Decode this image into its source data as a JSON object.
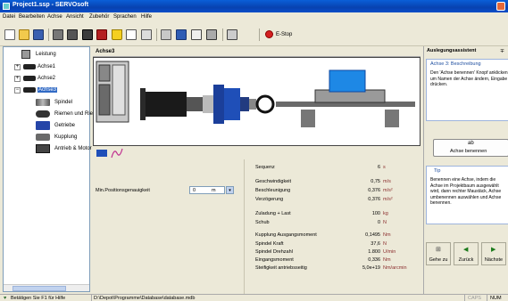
{
  "window": {
    "title": "Project1.ssp - SERVOsoft"
  },
  "menu": [
    "Datei",
    "Bearbeiten",
    "Achse",
    "Ansicht",
    "Zubehör",
    "Sprachen",
    "Hilfe"
  ],
  "toolbar": {
    "icons": [
      "new-file-icon",
      "open-folder-icon",
      "save-icon",
      "print-icon",
      "print-preview-icon",
      "add-axis-icon",
      "remove-axis-icon",
      "warning-icon",
      "report-icon",
      "calculator-icon",
      "panel-icon",
      "database-icon",
      "chart-icon",
      "arrows-icon",
      "tools-icon"
    ],
    "estop_label": "E-Stop"
  },
  "tree": {
    "items": [
      {
        "label": "Leistung",
        "icon": "power-supply-icon"
      },
      {
        "label": "Achse1",
        "icon": "motor-icon"
      },
      {
        "label": "Achse2",
        "icon": "motor-icon"
      },
      {
        "label": "Achse3",
        "icon": "motor-icon"
      },
      {
        "label": "Spindel",
        "icon": "spindle-icon"
      },
      {
        "label": "Riemen und Rien",
        "icon": "belt-icon"
      },
      {
        "label": "Getriebe",
        "icon": "gearbox-icon"
      },
      {
        "label": "Kupplung",
        "icon": "coupling-icon"
      },
      {
        "label": "Antrieb & Motor",
        "icon": "drive-motor-icon"
      }
    ]
  },
  "main": {
    "header": "Achse3"
  },
  "params": {
    "min_pos_label": "Min.Positionsgenauigkeit",
    "min_pos_value": "0",
    "min_pos_unit": "m",
    "rows": [
      {
        "k": "Sequenz",
        "v": "6",
        "u": "s"
      },
      {
        "k": "Geschwindigkeit",
        "v": "0,75",
        "u": "m/s"
      },
      {
        "k": "Beschleunigung",
        "v": "0,376",
        "u": "m/s²"
      },
      {
        "k": "Verzögerung",
        "v": "0,376",
        "u": "m/s²"
      },
      {
        "k": "Zuladung + Last",
        "v": "100",
        "u": "kg"
      },
      {
        "k": "Schub",
        "v": "0",
        "u": "N"
      },
      {
        "k": "Kupplung Ausgangsmoment",
        "v": "0,1495",
        "u": "Nm"
      },
      {
        "k": "Spindel Kraft",
        "v": "37,6",
        "u": "N"
      },
      {
        "k": "Spindel Drehzahl",
        "v": "1.800",
        "u": "U/min"
      },
      {
        "k": "Eingangsmoment",
        "v": "0,336",
        "u": "Nm"
      },
      {
        "k": "Steifigkeit antriebsseitig",
        "v": "5,0e+19",
        "u": "Nm/arcmin"
      }
    ]
  },
  "wizard": {
    "title": "Auslegungsassistent",
    "pin": "∓",
    "step_title": "Achse 3: Beschreibung",
    "step_text": "Den 'Achse benennen' Knopf anklicken um Namen der Achse ändern, Eingabe drücken.",
    "rename_button_icon": "ab",
    "rename_button": "Achse benennen",
    "tip_title": "Tip",
    "tip_text": "Benennen eine Achse, indem die Achse im Projektbaum ausgewählt wird, dann rechter Maustäck, Achse umbenennen auswählen und Achse benennen.",
    "nav": [
      {
        "label": "Gehe zu",
        "icon": "goto-icon"
      },
      {
        "label": "Zurück",
        "icon": "back-arrow-icon"
      },
      {
        "label": "Nächste",
        "icon": "next-arrow-icon"
      }
    ]
  },
  "status": {
    "hint": "Betätigen Sie F1 für Hilfe",
    "path": "D:\\Depot\\Programme\\Database\\database.mdb",
    "caps": "CAPS",
    "num": "NUM"
  }
}
